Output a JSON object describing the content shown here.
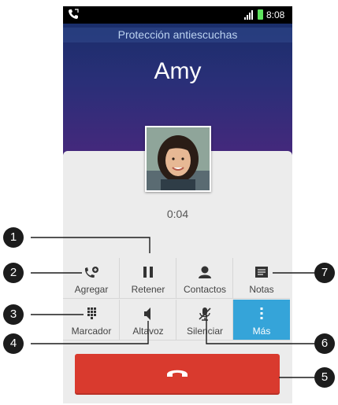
{
  "status_bar": {
    "time": "8:08",
    "left_icon": "phone-call-icon",
    "signal_icon": "signal-icon",
    "battery_icon": "battery-icon",
    "battery_color": "#5ee35e"
  },
  "call": {
    "banner": "Protección antiescuchas",
    "contact_name": "Amy",
    "duration": "0:04"
  },
  "actions": [
    {
      "label": "Agregar",
      "icon": "add-call-icon"
    },
    {
      "label": "Retener",
      "icon": "pause-icon"
    },
    {
      "label": "Contactos",
      "icon": "person-icon"
    },
    {
      "label": "Notas",
      "icon": "notes-icon"
    },
    {
      "label": "Marcador",
      "icon": "dialpad-icon"
    },
    {
      "label": "Altavoz",
      "icon": "speaker-icon"
    },
    {
      "label": "Silenciar",
      "icon": "mute-mic-icon"
    },
    {
      "label": "Más",
      "icon": "more-icon"
    }
  ],
  "end_call": {
    "icon": "hang-up-icon",
    "color": "#d93a2e"
  },
  "accent_color": "#35a4d9",
  "callouts": [
    "1",
    "2",
    "3",
    "4",
    "5",
    "6",
    "7"
  ]
}
